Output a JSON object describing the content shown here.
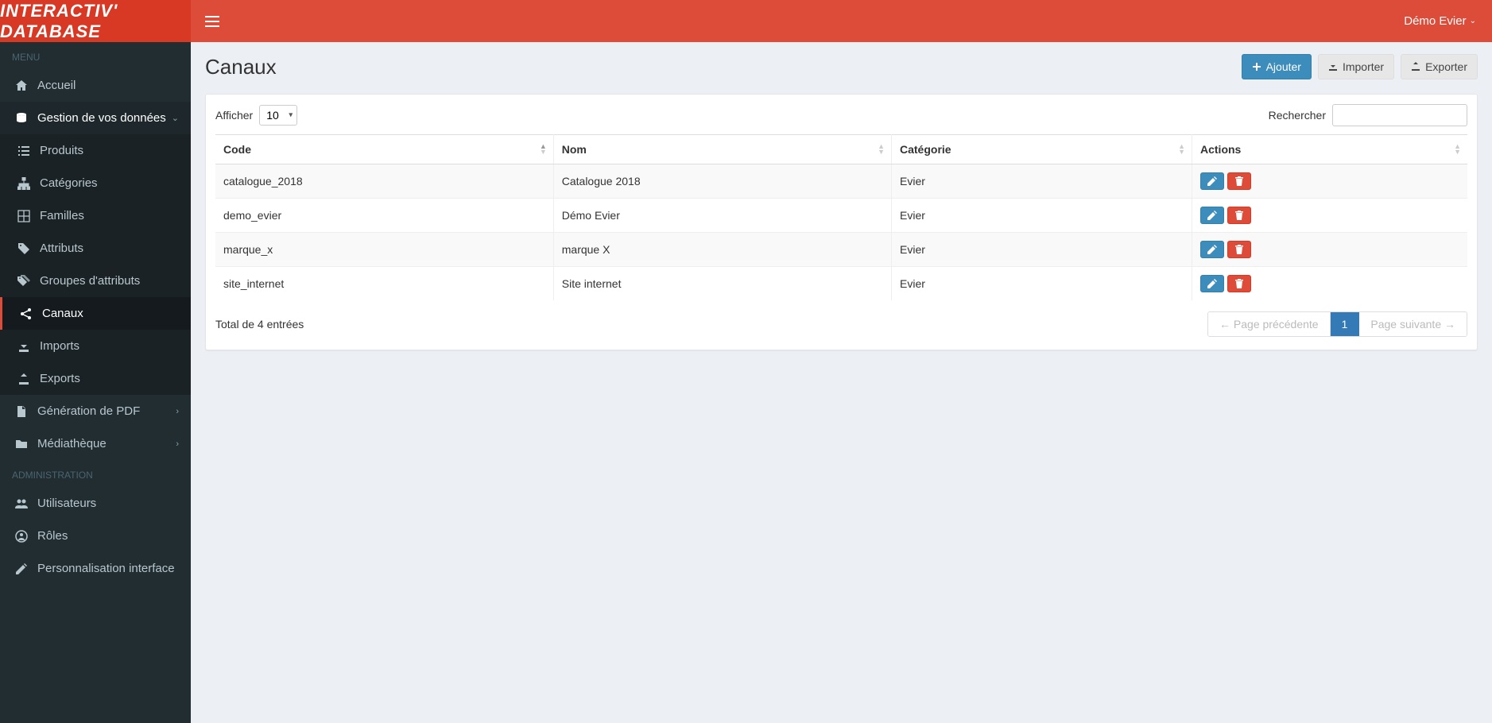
{
  "brand": "INTERACTIV' DATABASE",
  "user": {
    "name": "Démo Evier"
  },
  "sidebar": {
    "heading_menu": "MENU",
    "heading_admin": "ADMINISTRATION",
    "items": {
      "accueil": "Accueil",
      "gestion": "Gestion de vos données",
      "produits": "Produits",
      "categories": "Catégories",
      "familles": "Familles",
      "attributs": "Attributs",
      "groupes": "Groupes d'attributs",
      "canaux": "Canaux",
      "imports": "Imports",
      "exports": "Exports",
      "pdf": "Génération de PDF",
      "media": "Médiathèque",
      "utilisateurs": "Utilisateurs",
      "roles": "Rôles",
      "perso": "Personnalisation interface"
    }
  },
  "page": {
    "title": "Canaux",
    "toolbar": {
      "add": "Ajouter",
      "import": "Importer",
      "export": "Exporter"
    }
  },
  "table": {
    "show_label": "Afficher",
    "page_size": "10",
    "search_label": "Rechercher",
    "columns": {
      "code": "Code",
      "nom": "Nom",
      "categorie": "Catégorie",
      "actions": "Actions"
    },
    "rows": [
      {
        "code": "catalogue_2018",
        "nom": "Catalogue 2018",
        "categorie": "Evier"
      },
      {
        "code": "demo_evier",
        "nom": "Démo Evier",
        "categorie": "Evier"
      },
      {
        "code": "marque_x",
        "nom": "marque X",
        "categorie": "Evier"
      },
      {
        "code": "site_internet",
        "nom": "Site internet",
        "categorie": "Evier"
      }
    ],
    "total_text": "Total de 4 entrées",
    "pagination": {
      "prev": "← Page précédente",
      "current": "1",
      "next": "Page suivante →"
    }
  }
}
